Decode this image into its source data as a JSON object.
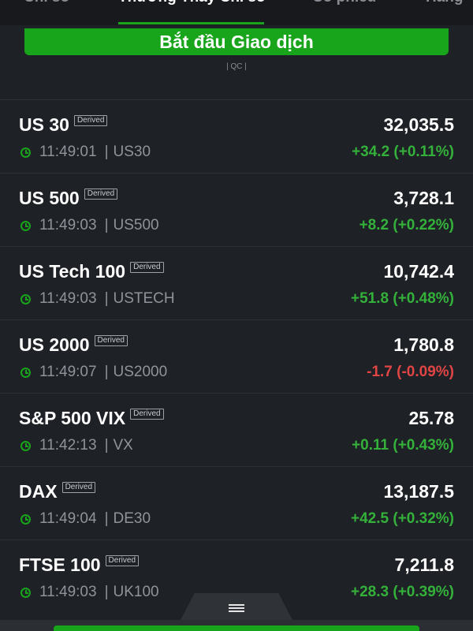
{
  "tabs": [
    {
      "label": "Chỉ số"
    },
    {
      "label": "Thường Thấy Chỉ số"
    },
    {
      "label": "Cổ phiếu"
    },
    {
      "label": "Hàng"
    }
  ],
  "cta": {
    "label": "Bắt đầu Giao dịch"
  },
  "ad_label": "| QC |",
  "colors": {
    "accent": "#19a51b",
    "positive": "#34b13a",
    "negative": "#e04545"
  },
  "quotes": [
    {
      "name": "US 30",
      "badge": "Derived",
      "price": "32,035.5",
      "time": "11:49:01",
      "symbol": "US30",
      "change": "+34.2 (+0.11%)",
      "direction": "up"
    },
    {
      "name": "US 500",
      "badge": "Derived",
      "price": "3,728.1",
      "time": "11:49:03",
      "symbol": "US500",
      "change": "+8.2 (+0.22%)",
      "direction": "up"
    },
    {
      "name": "US Tech 100",
      "badge": "Derived",
      "price": "10,742.4",
      "time": "11:49:03",
      "symbol": "USTECH",
      "change": "+51.8 (+0.48%)",
      "direction": "up"
    },
    {
      "name": "US 2000",
      "badge": "Derived",
      "price": "1,780.8",
      "time": "11:49:07",
      "symbol": "US2000",
      "change": "-1.7 (-0.09%)",
      "direction": "down"
    },
    {
      "name": "S&P 500 VIX",
      "badge": "Derived",
      "price": "25.78",
      "time": "11:42:13",
      "symbol": "VX",
      "change": "+0.11 (+0.43%)",
      "direction": "up"
    },
    {
      "name": "DAX",
      "badge": "Derived",
      "price": "13,187.5",
      "time": "11:49:04",
      "symbol": "DE30",
      "change": "+42.5 (+0.32%)",
      "direction": "up"
    },
    {
      "name": "FTSE 100",
      "badge": "Derived",
      "price": "7,211.8",
      "time": "11:49:03",
      "symbol": "UK100",
      "change": "+28.3 (+0.39%)",
      "direction": "up"
    }
  ],
  "icons": {
    "clock": "clock-icon",
    "handle": "menu-icon"
  }
}
